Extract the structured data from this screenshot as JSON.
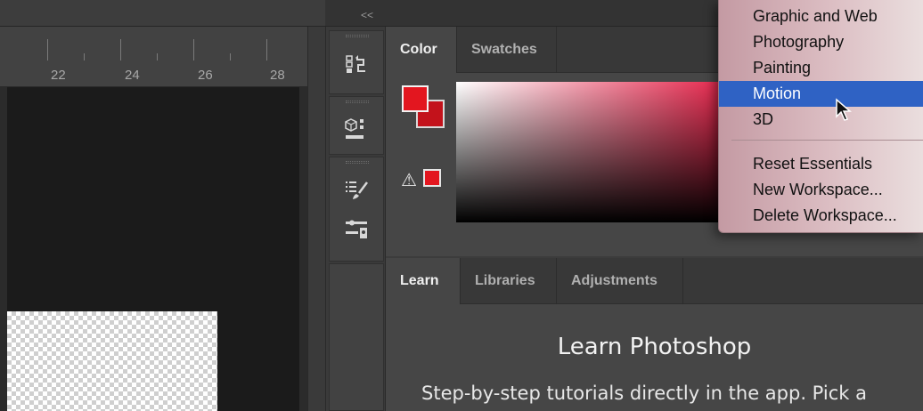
{
  "ruler": {
    "labels": [
      "22",
      "24",
      "26",
      "28"
    ]
  },
  "collapse": {
    "label": "<<"
  },
  "tools": {
    "icons": [
      "history-icon",
      "3d-object-icon",
      "brush-settings-icon",
      "properties-icon"
    ]
  },
  "color_panel": {
    "tabs": [
      "Color",
      "Swatches"
    ],
    "foreground_color": "#e3161f",
    "background_color": "#c3121b",
    "warning_symbol": "⚠"
  },
  "learn_panel": {
    "tabs": [
      "Learn",
      "Libraries",
      "Adjustments"
    ],
    "title": "Learn Photoshop",
    "description": "Step-by-step tutorials directly in the app. Pick a"
  },
  "workspace_menu": {
    "items": [
      "Graphic and Web",
      "Photography",
      "Painting",
      "Motion",
      "3D"
    ],
    "highlighted": "Motion",
    "actions": [
      "Reset Essentials",
      "New Workspace...",
      "Delete Workspace..."
    ]
  }
}
